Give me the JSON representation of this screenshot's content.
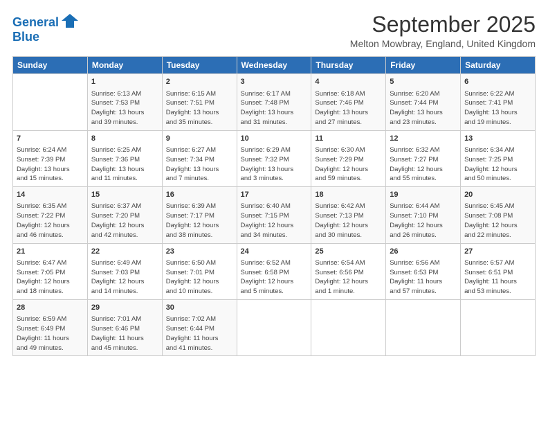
{
  "header": {
    "logo_line1": "General",
    "logo_line2": "Blue",
    "month": "September 2025",
    "location": "Melton Mowbray, England, United Kingdom"
  },
  "days_of_week": [
    "Sunday",
    "Monday",
    "Tuesday",
    "Wednesday",
    "Thursday",
    "Friday",
    "Saturday"
  ],
  "weeks": [
    [
      {
        "day": "",
        "content": ""
      },
      {
        "day": "1",
        "content": "Sunrise: 6:13 AM\nSunset: 7:53 PM\nDaylight: 13 hours\nand 39 minutes."
      },
      {
        "day": "2",
        "content": "Sunrise: 6:15 AM\nSunset: 7:51 PM\nDaylight: 13 hours\nand 35 minutes."
      },
      {
        "day": "3",
        "content": "Sunrise: 6:17 AM\nSunset: 7:48 PM\nDaylight: 13 hours\nand 31 minutes."
      },
      {
        "day": "4",
        "content": "Sunrise: 6:18 AM\nSunset: 7:46 PM\nDaylight: 13 hours\nand 27 minutes."
      },
      {
        "day": "5",
        "content": "Sunrise: 6:20 AM\nSunset: 7:44 PM\nDaylight: 13 hours\nand 23 minutes."
      },
      {
        "day": "6",
        "content": "Sunrise: 6:22 AM\nSunset: 7:41 PM\nDaylight: 13 hours\nand 19 minutes."
      }
    ],
    [
      {
        "day": "7",
        "content": "Sunrise: 6:24 AM\nSunset: 7:39 PM\nDaylight: 13 hours\nand 15 minutes."
      },
      {
        "day": "8",
        "content": "Sunrise: 6:25 AM\nSunset: 7:36 PM\nDaylight: 13 hours\nand 11 minutes."
      },
      {
        "day": "9",
        "content": "Sunrise: 6:27 AM\nSunset: 7:34 PM\nDaylight: 13 hours\nand 7 minutes."
      },
      {
        "day": "10",
        "content": "Sunrise: 6:29 AM\nSunset: 7:32 PM\nDaylight: 13 hours\nand 3 minutes."
      },
      {
        "day": "11",
        "content": "Sunrise: 6:30 AM\nSunset: 7:29 PM\nDaylight: 12 hours\nand 59 minutes."
      },
      {
        "day": "12",
        "content": "Sunrise: 6:32 AM\nSunset: 7:27 PM\nDaylight: 12 hours\nand 55 minutes."
      },
      {
        "day": "13",
        "content": "Sunrise: 6:34 AM\nSunset: 7:25 PM\nDaylight: 12 hours\nand 50 minutes."
      }
    ],
    [
      {
        "day": "14",
        "content": "Sunrise: 6:35 AM\nSunset: 7:22 PM\nDaylight: 12 hours\nand 46 minutes."
      },
      {
        "day": "15",
        "content": "Sunrise: 6:37 AM\nSunset: 7:20 PM\nDaylight: 12 hours\nand 42 minutes."
      },
      {
        "day": "16",
        "content": "Sunrise: 6:39 AM\nSunset: 7:17 PM\nDaylight: 12 hours\nand 38 minutes."
      },
      {
        "day": "17",
        "content": "Sunrise: 6:40 AM\nSunset: 7:15 PM\nDaylight: 12 hours\nand 34 minutes."
      },
      {
        "day": "18",
        "content": "Sunrise: 6:42 AM\nSunset: 7:13 PM\nDaylight: 12 hours\nand 30 minutes."
      },
      {
        "day": "19",
        "content": "Sunrise: 6:44 AM\nSunset: 7:10 PM\nDaylight: 12 hours\nand 26 minutes."
      },
      {
        "day": "20",
        "content": "Sunrise: 6:45 AM\nSunset: 7:08 PM\nDaylight: 12 hours\nand 22 minutes."
      }
    ],
    [
      {
        "day": "21",
        "content": "Sunrise: 6:47 AM\nSunset: 7:05 PM\nDaylight: 12 hours\nand 18 minutes."
      },
      {
        "day": "22",
        "content": "Sunrise: 6:49 AM\nSunset: 7:03 PM\nDaylight: 12 hours\nand 14 minutes."
      },
      {
        "day": "23",
        "content": "Sunrise: 6:50 AM\nSunset: 7:01 PM\nDaylight: 12 hours\nand 10 minutes."
      },
      {
        "day": "24",
        "content": "Sunrise: 6:52 AM\nSunset: 6:58 PM\nDaylight: 12 hours\nand 5 minutes."
      },
      {
        "day": "25",
        "content": "Sunrise: 6:54 AM\nSunset: 6:56 PM\nDaylight: 12 hours\nand 1 minute."
      },
      {
        "day": "26",
        "content": "Sunrise: 6:56 AM\nSunset: 6:53 PM\nDaylight: 11 hours\nand 57 minutes."
      },
      {
        "day": "27",
        "content": "Sunrise: 6:57 AM\nSunset: 6:51 PM\nDaylight: 11 hours\nand 53 minutes."
      }
    ],
    [
      {
        "day": "28",
        "content": "Sunrise: 6:59 AM\nSunset: 6:49 PM\nDaylight: 11 hours\nand 49 minutes."
      },
      {
        "day": "29",
        "content": "Sunrise: 7:01 AM\nSunset: 6:46 PM\nDaylight: 11 hours\nand 45 minutes."
      },
      {
        "day": "30",
        "content": "Sunrise: 7:02 AM\nSunset: 6:44 PM\nDaylight: 11 hours\nand 41 minutes."
      },
      {
        "day": "",
        "content": ""
      },
      {
        "day": "",
        "content": ""
      },
      {
        "day": "",
        "content": ""
      },
      {
        "day": "",
        "content": ""
      }
    ]
  ]
}
